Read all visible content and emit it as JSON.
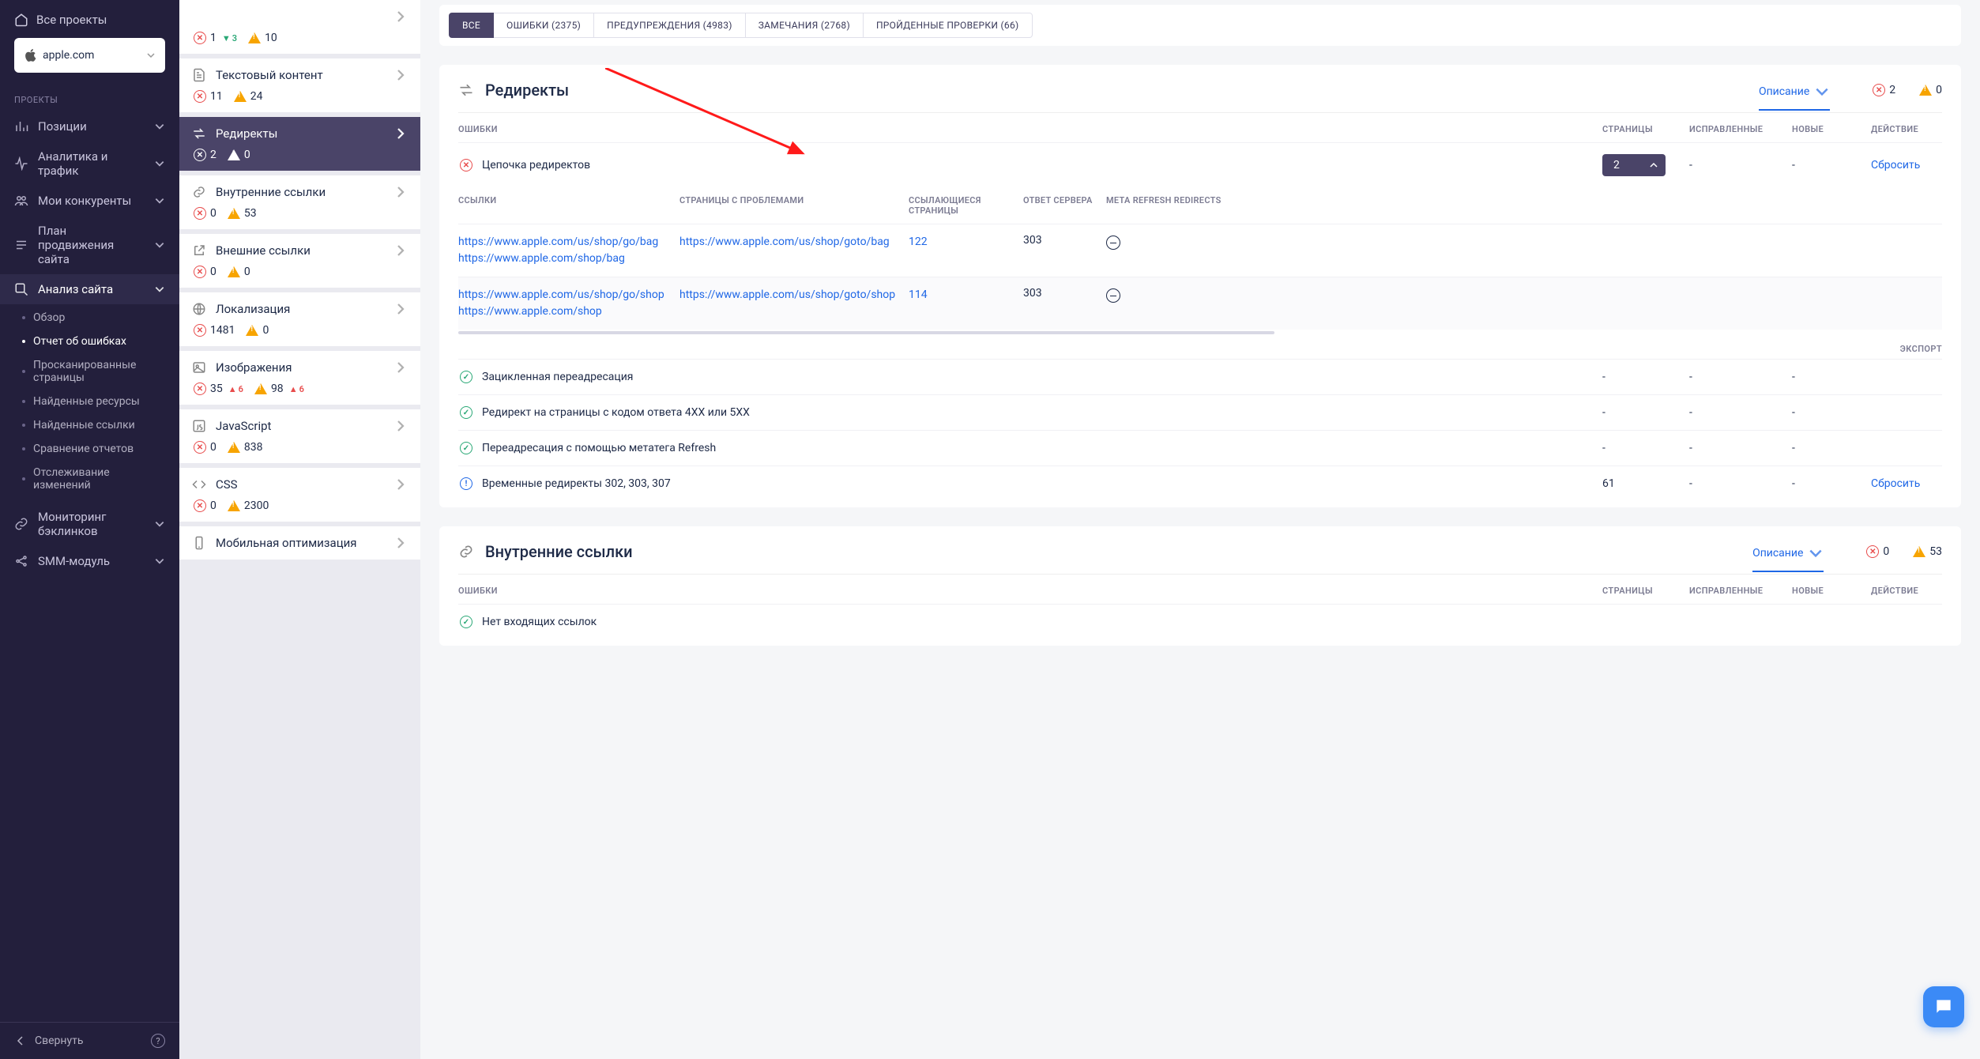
{
  "sidebar": {
    "home": "Все проекты",
    "project": "apple.com",
    "section_label": "ПРОЕКТЫ",
    "items": [
      {
        "label": "Позиции"
      },
      {
        "label": "Аналитика и трафик"
      },
      {
        "label": "Мои конкуренты"
      },
      {
        "label": "План продвижения сайта"
      },
      {
        "label": "Анализ сайта",
        "expanded": true
      },
      {
        "label": "Мониторинг бэклинков"
      },
      {
        "label": "SMM-модуль"
      }
    ],
    "sub_analysis": [
      {
        "label": "Обзор"
      },
      {
        "label": "Отчет об ошибках",
        "active": true
      },
      {
        "label": "Просканированные страницы"
      },
      {
        "label": "Найденные ресурсы"
      },
      {
        "label": "Найденные ссылки"
      },
      {
        "label": "Сравнение отчетов"
      },
      {
        "label": "Отслеживание изменений"
      }
    ],
    "collapse": "Свернуть"
  },
  "tabs": [
    {
      "label": "ВСЕ",
      "active": true
    },
    {
      "label": "ОШИБКИ (2375)"
    },
    {
      "label": "ПРЕДУПРЕЖДЕНИЯ (4983)"
    },
    {
      "label": "ЗАМЕЧАНИЯ (2768)"
    },
    {
      "label": "ПРОЙДЕННЫЕ ПРОВЕРКИ (66)"
    }
  ],
  "categories": [
    {
      "icon": "tag",
      "title": "",
      "err": "1",
      "err_delta": "3",
      "err_dir": "down",
      "warn": "10"
    },
    {
      "icon": "doc",
      "title": "Текстовый контент",
      "err": "11",
      "warn": "24"
    },
    {
      "icon": "redirect",
      "title": "Редиректы",
      "err": "2",
      "warn": "0",
      "active": true
    },
    {
      "icon": "link",
      "title": "Внутренние ссылки",
      "err": "0",
      "warn": "53"
    },
    {
      "icon": "ext",
      "title": "Внешние ссылки",
      "err": "0",
      "warn": "0"
    },
    {
      "icon": "globe",
      "title": "Локализация",
      "err": "1481",
      "warn": "0"
    },
    {
      "icon": "image",
      "title": "Изображения",
      "err": "35",
      "err_delta": "6",
      "err_dir": "up",
      "warn": "98",
      "warn_delta": "6",
      "warn_dir": "up"
    },
    {
      "icon": "js",
      "title": "JavaScript",
      "err": "0",
      "warn": "838"
    },
    {
      "icon": "code",
      "title": "CSS",
      "err": "0",
      "warn": "2300"
    },
    {
      "icon": "mobile",
      "title": "Мобильная оптимизация"
    }
  ],
  "redirects": {
    "title": "Редиректы",
    "desc_label": "Описание",
    "err_count": "2",
    "warn_count": "0",
    "cols": {
      "err": "ОШИБКИ",
      "pages": "СТРАНИЦЫ",
      "fixed": "ИСПРАВЛЕННЫЕ",
      "new": "НОВЫЕ",
      "act": "ДЕЙСТВИЕ"
    },
    "row_chain": {
      "name": "Цепочка редиректов",
      "count": "2",
      "reset": "Сбросить"
    },
    "sub_cols": {
      "links": "ССЫЛКИ",
      "problem": "СТРАНИЦЫ С ПРОБЛЕМАМИ",
      "ref": "ССЫЛАЮЩИЕСЯ СТРАНИЦЫ",
      "resp": "ОТВЕТ СЕРВЕРА",
      "meta": "META REFRESH REDIRECTS"
    },
    "details": [
      {
        "l1": "https://www.apple.com/us/shop/go/bag",
        "l2": "https://www.apple.com/shop/bag",
        "problem": "https://www.apple.com/us/shop/goto/bag",
        "ref": "122",
        "resp": "303"
      },
      {
        "l1": "https://www.apple.com/us/shop/go/shop",
        "l2": "https://www.apple.com/shop",
        "problem": "https://www.apple.com/us/shop/goto/shop",
        "ref": "114",
        "resp": "303"
      }
    ],
    "export": "ЭКСПОРТ",
    "rows_rest": [
      {
        "ic": "ok",
        "name": "Зацикленная переадресация",
        "pages": "-",
        "fixed": "-",
        "new": "-"
      },
      {
        "ic": "ok",
        "name": "Редирект на страницы с кодом ответа 4XX или 5XX",
        "pages": "-",
        "fixed": "-",
        "new": "-"
      },
      {
        "ic": "ok",
        "name": "Переадресация с помощью метатега Refresh",
        "pages": "-",
        "fixed": "-",
        "new": "-"
      },
      {
        "ic": "info",
        "name": "Временные редиректы 302, 303, 307",
        "pages": "61",
        "fixed": "-",
        "new": "-",
        "reset": "Сбросить"
      }
    ]
  },
  "internal_links": {
    "title": "Внутренние ссылки",
    "desc_label": "Описание",
    "err_count": "0",
    "warn_count": "53",
    "cols": {
      "err": "ОШИБКИ",
      "pages": "СТРАНИЦЫ",
      "fixed": "ИСПРАВЛЕННЫЕ",
      "new": "НОВЫЕ",
      "act": "ДЕЙСТВИЕ"
    },
    "rows": [
      {
        "ic": "ok",
        "name": "Нет входящих ссылок"
      }
    ]
  }
}
